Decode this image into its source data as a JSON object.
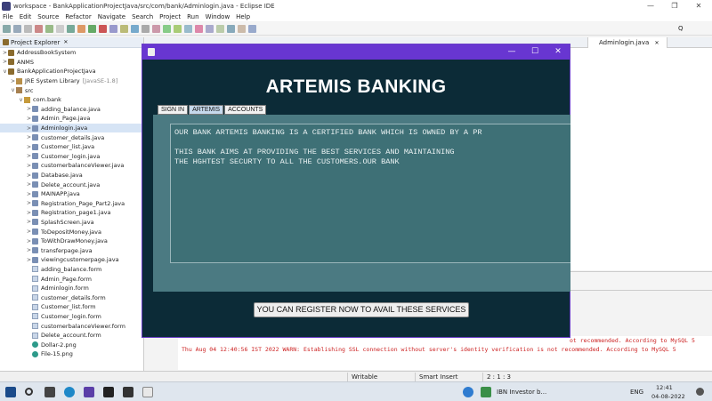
{
  "eclipse": {
    "window_title": "workspace - BankApplicationProjectJava/src/com/bank/Adminlogin.java - Eclipse IDE",
    "minimize": "—",
    "maximize": "❐",
    "close": "✕",
    "menu": [
      "File",
      "Edit",
      "Source",
      "Refactor",
      "Navigate",
      "Search",
      "Project",
      "Run",
      "Window",
      "Help"
    ],
    "quick_access_label": "Q"
  },
  "explorer": {
    "title": "Project Explorer",
    "close_x": "✕",
    "tree": [
      {
        "label": "AddressBookSystem",
        "indent": 1,
        "icon": "project",
        "arrow": ">"
      },
      {
        "label": "ANMS",
        "indent": 1,
        "icon": "project",
        "arrow": ">"
      },
      {
        "label": "BankApplicationProjectJava",
        "indent": 1,
        "icon": "project",
        "arrow": "v"
      },
      {
        "label": "JRE System Library",
        "extra": "[JavaSE-1.8]",
        "indent": 2,
        "icon": "lib",
        "arrow": ">"
      },
      {
        "label": "src",
        "indent": 2,
        "icon": "src",
        "arrow": "v"
      },
      {
        "label": "com.bank",
        "indent": 3,
        "icon": "pkg",
        "arrow": "v"
      },
      {
        "label": "adding_balance.java",
        "indent": 4,
        "icon": "java",
        "arrow": ">"
      },
      {
        "label": "Admin_Page.java",
        "indent": 4,
        "icon": "java",
        "arrow": ">"
      },
      {
        "label": "Adminlogin.java",
        "indent": 4,
        "icon": "java",
        "arrow": ">",
        "selected": true
      },
      {
        "label": "customer_details.java",
        "indent": 4,
        "icon": "java",
        "arrow": ">"
      },
      {
        "label": "Customer_list.java",
        "indent": 4,
        "icon": "java",
        "arrow": ">"
      },
      {
        "label": "Customer_login.java",
        "indent": 4,
        "icon": "java",
        "arrow": ">"
      },
      {
        "label": "customerbalanceViewer.java",
        "indent": 4,
        "icon": "java",
        "arrow": ">"
      },
      {
        "label": "Database.java",
        "indent": 4,
        "icon": "java",
        "arrow": ">"
      },
      {
        "label": "Delete_account.java",
        "indent": 4,
        "icon": "java",
        "arrow": ">"
      },
      {
        "label": "MAINAPP.java",
        "indent": 4,
        "icon": "java",
        "arrow": ">"
      },
      {
        "label": "Registration_Page_Part2.java",
        "indent": 4,
        "icon": "java",
        "arrow": ">"
      },
      {
        "label": "Registration_page1.java",
        "indent": 4,
        "icon": "java",
        "arrow": ">"
      },
      {
        "label": "SplashScreen.java",
        "indent": 4,
        "icon": "java",
        "arrow": ">"
      },
      {
        "label": "ToDepositMoney.java",
        "indent": 4,
        "icon": "java",
        "arrow": ">"
      },
      {
        "label": "ToWithDrawMoney.java",
        "indent": 4,
        "icon": "java",
        "arrow": ">"
      },
      {
        "label": "transferpage.java",
        "indent": 4,
        "icon": "java",
        "arrow": ">"
      },
      {
        "label": "viewingcustomerpage.java",
        "indent": 4,
        "icon": "java",
        "arrow": ">"
      },
      {
        "label": "adding_balance.form",
        "indent": 4,
        "icon": "form",
        "arrow": ""
      },
      {
        "label": "Admin_Page.form",
        "indent": 4,
        "icon": "form",
        "arrow": ""
      },
      {
        "label": "Adminlogin.form",
        "indent": 4,
        "icon": "form",
        "arrow": ""
      },
      {
        "label": "customer_details.form",
        "indent": 4,
        "icon": "form",
        "arrow": ""
      },
      {
        "label": "Customer_list.form",
        "indent": 4,
        "icon": "form",
        "arrow": ""
      },
      {
        "label": "Customer_login.form",
        "indent": 4,
        "icon": "form",
        "arrow": ""
      },
      {
        "label": "customerbalanceViewer.form",
        "indent": 4,
        "icon": "form",
        "arrow": ""
      },
      {
        "label": "Delete_account.form",
        "indent": 4,
        "icon": "form",
        "arrow": ""
      },
      {
        "label": "Dollar-2.png",
        "indent": 4,
        "icon": "png",
        "arrow": ""
      },
      {
        "label": "File-15.png",
        "indent": 4,
        "icon": "png",
        "arrow": ""
      }
    ]
  },
  "editor": {
    "active_tab": "Adminlogin.java",
    "active_tab_close": "✕"
  },
  "console": {
    "lines": [
      "ot recommended. According to MySQL 5",
      "Thu Aug 04 12:40:56 IST 2022 WARN: Establishing SSL connection without server's identity verification is not recommended. According to MySQL 5"
    ]
  },
  "status": {
    "writable": "Writable",
    "insert_mode": "Smart Insert",
    "position": "2 : 1 : 3"
  },
  "taskbar": {
    "stock_ticker": "IBN  Investor b...",
    "language": "ENG",
    "time": "12:41",
    "date": "04-08-2022"
  },
  "swing_app": {
    "minimize": "—",
    "maximize": "☐",
    "close": "✕",
    "title": "ARTEMIS BANKING",
    "tabs": [
      "SIGN IN",
      "ARTEMIS",
      "ACCOUNTS"
    ],
    "active_tab_index": 1,
    "about_text": [
      "OUR BANK ARTEMIS BANKING IS A CERTIFIED BANK WHICH IS OWNED BY A PR",
      "",
      "THIS BANK AIMS AT PROVIDING THE BEST SERVICES AND MAINTAINING",
      "THE HGHTEST SECURTY TO ALL THE CUSTOMERS.OUR BANK"
    ],
    "register_button": "YOU CAN REGISTER NOW TO AVAIL THESE SERVICES"
  }
}
